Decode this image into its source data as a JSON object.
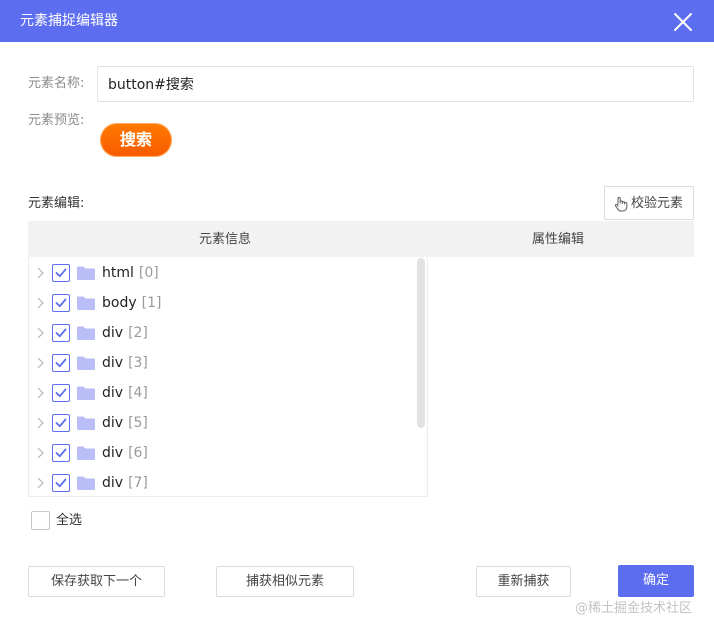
{
  "dialog": {
    "title": "元素捕捉编辑器"
  },
  "element_name": {
    "label": "元素名称:",
    "value": "button#搜索"
  },
  "element_preview": {
    "label": "元素预览:",
    "button_text": "搜索"
  },
  "element_edit": {
    "label": "元素编辑:",
    "verify_button": "校验元素",
    "columns": [
      "元素信息",
      "属性编辑"
    ],
    "tree": [
      {
        "tag": "html",
        "index": "[0]",
        "checked": true
      },
      {
        "tag": "body",
        "index": "[1]",
        "checked": true
      },
      {
        "tag": "div",
        "index": "[2]",
        "checked": true
      },
      {
        "tag": "div",
        "index": "[3]",
        "checked": true
      },
      {
        "tag": "div",
        "index": "[4]",
        "checked": true
      },
      {
        "tag": "div",
        "index": "[5]",
        "checked": true
      },
      {
        "tag": "div",
        "index": "[6]",
        "checked": true
      },
      {
        "tag": "div",
        "index": "[7]",
        "checked": true
      }
    ]
  },
  "select_all": {
    "label": "全选",
    "checked": false
  },
  "footer": {
    "save_next": "保存获取下一个",
    "capture_similar": "捕获相似元素",
    "recapture": "重新捕获",
    "confirm": "确定"
  },
  "watermark": "@稀土掘金技术社区",
  "colors": {
    "accent": "#5d6df0",
    "preview_button": "#f85a00"
  }
}
